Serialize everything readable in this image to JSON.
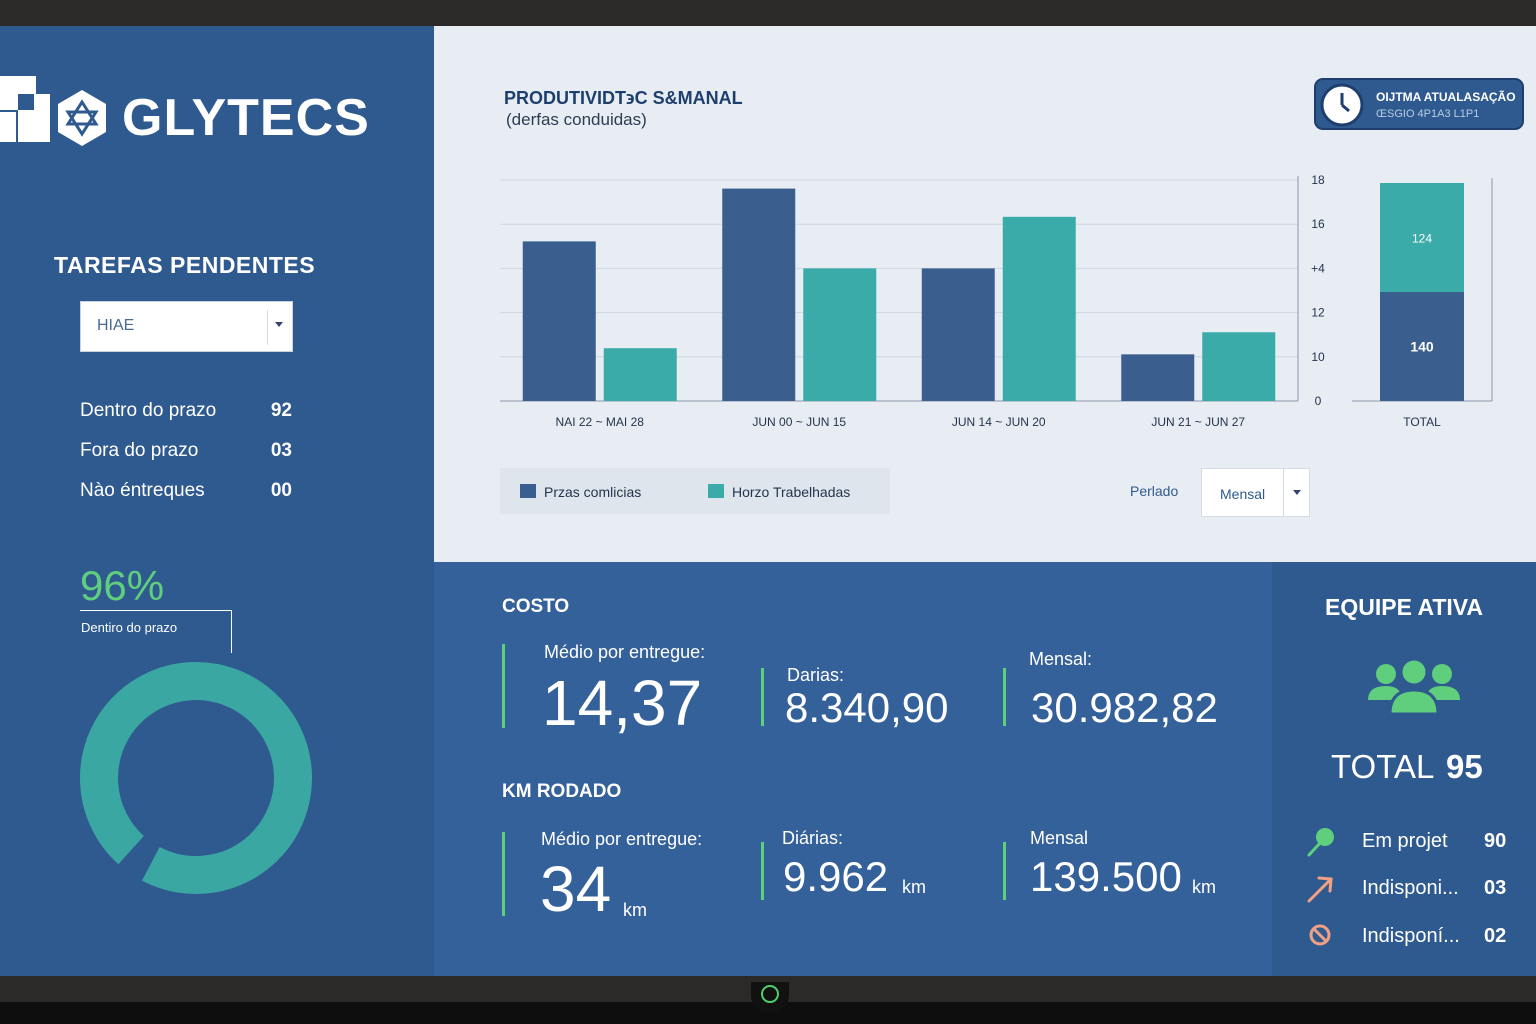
{
  "brand": {
    "name": "GLYTECS"
  },
  "sidebar": {
    "title": "TAREFAS PENDENTES",
    "filter_value": "HIAE",
    "stats": [
      {
        "label": "Dentro do prazo",
        "value": "92"
      },
      {
        "label": "Fora do prazo",
        "value": "03"
      },
      {
        "label": "Nào éntreques",
        "value": "00"
      }
    ],
    "percent": "96%",
    "percent_label": "Dentiro do prazo",
    "donut_fraction": 0.96,
    "donut_color": "#3aa7a3"
  },
  "chart_panel": {
    "title": "PRODUTIVIDT϶C S&MANAL",
    "subtitle": "(derfas conduidas)",
    "update_line1": "OIJTMA ATUALASAÇÃO",
    "update_line2": "ŒSGIO  4P1A3 L1P1",
    "legend": [
      "Przas comlicias",
      "Horzo Trabelhadas"
    ],
    "period_label": "Perlado",
    "period_value": "Mensal"
  },
  "chart_data": {
    "type": "bar",
    "categories": [
      "NAI 22 ~ MAI 28",
      "JUN 00 ~ JUN 15",
      "JUN 14 ~ JUN 20",
      "JUN 21 ~ JUN 27"
    ],
    "series": [
      {
        "name": "Przas comlicias",
        "values": [
          13,
          17.3,
          10.8,
          3.8
        ],
        "color": "#3a5f8f"
      },
      {
        "name": "Horzo Trabelhadas",
        "values": [
          4.3,
          10.8,
          15,
          5.6
        ],
        "color": "#3aaba8"
      }
    ],
    "y_ticks": [
      "0",
      "10",
      "12",
      "+4",
      "16",
      "18"
    ],
    "total": {
      "label": "TOTAL",
      "bottom_value": "140",
      "top_value": "124",
      "bottom_color": "#3a5f8f",
      "top_color": "#3aaba8",
      "bottom_share": 0.5,
      "top_share": 0.5
    },
    "ylim": [
      0,
      18
    ],
    "grid": true
  },
  "cost": {
    "title": "COSTO",
    "avg_label": "Médio por entregue:",
    "avg_value": "14,37",
    "daily_label": "Darias:",
    "daily_value": "8.340,90",
    "monthly_label": "Mensal:",
    "monthly_value": "30.982,82"
  },
  "km": {
    "title": "KM RODADO",
    "avg_label": "Médio por entregue:",
    "avg_value": "34",
    "daily_label": "Diárias:",
    "daily_value": "9.962",
    "monthly_label": "Mensal",
    "monthly_value": "139.500",
    "unit": "km"
  },
  "team": {
    "title": "EQUIPE ATIVA",
    "total_label": "TOTAL",
    "total_value": "95",
    "rows": [
      {
        "label": "Em projet",
        "value": "90",
        "icon": "map-pin-icon"
      },
      {
        "label": "Indisponi...",
        "value": "03",
        "icon": "arrow-up-right-icon"
      },
      {
        "label": "Indisponí...",
        "value": "02",
        "icon": "block-icon"
      }
    ]
  }
}
